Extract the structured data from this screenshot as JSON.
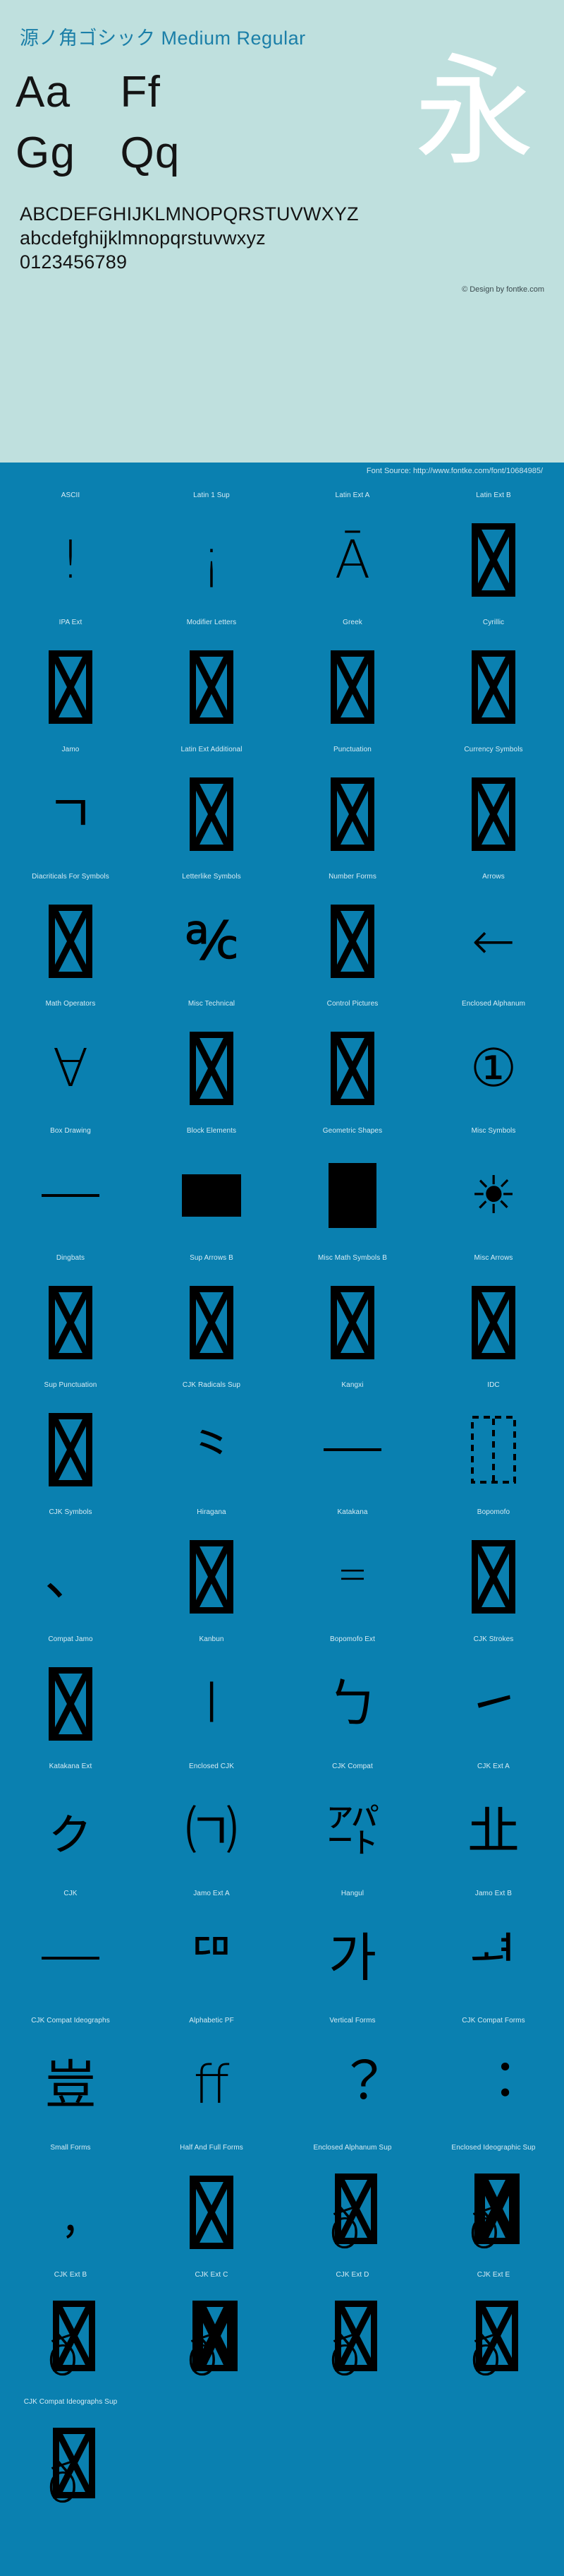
{
  "header": {
    "font_title": "源ノ角ゴシック Medium Regular",
    "specimen": {
      "row1_col1": "Aa",
      "row1_col2": "Ff",
      "row2_col1": "Gg",
      "row2_col2": "Qq",
      "cjk_sample": "永"
    },
    "alphabet_upper": "ABCDEFGHIJKLMNOPQRSTUVWXYZ",
    "alphabet_lower": "abcdefghijklmnopqrstuvwxyz",
    "digits": "0123456789",
    "copyright": "© Design by fontke.com"
  },
  "source_bar": {
    "text": "Font Source: http://www.fontke.com/font/10684985/"
  },
  "colors": {
    "header_bg": "#bfe0de",
    "body_bg": "#0a80b0",
    "title_color": "#1b7fa8",
    "glyph_color": "#000000",
    "label_color": "#d8ecf5",
    "cjk_sample_color": "#ffffff"
  },
  "blocks": [
    {
      "label": "ASCII",
      "glyph": "!",
      "kind": "glyph"
    },
    {
      "label": "Latin 1 Sup",
      "glyph": "¡",
      "kind": "glyph"
    },
    {
      "label": "Latin Ext A",
      "glyph": "Ā",
      "kind": "glyph"
    },
    {
      "label": "Latin Ext B",
      "glyph": "",
      "kind": "tofu"
    },
    {
      "label": "IPA Ext",
      "glyph": "",
      "kind": "tofu"
    },
    {
      "label": "Modifier Letters",
      "glyph": "",
      "kind": "tofu"
    },
    {
      "label": "Greek",
      "glyph": "",
      "kind": "tofu"
    },
    {
      "label": "Cyrillic",
      "glyph": "",
      "kind": "tofu"
    },
    {
      "label": "Jamo",
      "glyph": "ㄱ",
      "kind": "glyph"
    },
    {
      "label": "Latin Ext Additional",
      "glyph": "",
      "kind": "tofu"
    },
    {
      "label": "Punctuation",
      "glyph": "",
      "kind": "tofu"
    },
    {
      "label": "Currency Symbols",
      "glyph": "",
      "kind": "tofu"
    },
    {
      "label": "Diacriticals For Symbols",
      "glyph": "",
      "kind": "tofu"
    },
    {
      "label": "Letterlike Symbols",
      "glyph": "℀",
      "kind": "glyph"
    },
    {
      "label": "Number Forms",
      "glyph": "",
      "kind": "tofu"
    },
    {
      "label": "Arrows",
      "glyph": "←",
      "kind": "glyph"
    },
    {
      "label": "Math Operators",
      "glyph": "∀",
      "kind": "glyph"
    },
    {
      "label": "Misc Technical",
      "glyph": "",
      "kind": "tofu"
    },
    {
      "label": "Control Pictures",
      "glyph": "",
      "kind": "tofu"
    },
    {
      "label": "Enclosed Alphanum",
      "glyph": "①",
      "kind": "glyph"
    },
    {
      "label": "Box Drawing",
      "glyph": "─",
      "kind": "rule"
    },
    {
      "label": "Block Elements",
      "glyph": "█",
      "kind": "swatch-block"
    },
    {
      "label": "Geometric Shapes",
      "glyph": "■",
      "kind": "swatch-geom"
    },
    {
      "label": "Misc Symbols",
      "glyph": "☀",
      "kind": "glyph"
    },
    {
      "label": "Dingbats",
      "glyph": "",
      "kind": "tofu"
    },
    {
      "label": "Sup Arrows B",
      "glyph": "",
      "kind": "tofu"
    },
    {
      "label": "Misc Math Symbols B",
      "glyph": "",
      "kind": "tofu"
    },
    {
      "label": "Misc Arrows",
      "glyph": "",
      "kind": "tofu"
    },
    {
      "label": "Sup Punctuation",
      "glyph": "",
      "kind": "tofu"
    },
    {
      "label": "CJK Radicals Sup",
      "glyph": "⺀",
      "kind": "glyph"
    },
    {
      "label": "Kangxi",
      "glyph": "⼀",
      "kind": "rule"
    },
    {
      "label": "IDC",
      "glyph": "⿰",
      "kind": "dashed"
    },
    {
      "label": "CJK Symbols",
      "glyph": "、",
      "kind": "glyph"
    },
    {
      "label": "Hiragana",
      "glyph": "",
      "kind": "tofu"
    },
    {
      "label": "Katakana",
      "glyph": "゠",
      "kind": "glyph"
    },
    {
      "label": "Bopomofo",
      "glyph": "",
      "kind": "tofu"
    },
    {
      "label": "Compat Jamo",
      "glyph": "",
      "kind": "tofu"
    },
    {
      "label": "Kanbun",
      "glyph": "㆐",
      "kind": "glyph"
    },
    {
      "label": "Bopomofo Ext",
      "glyph": "ㄅ",
      "kind": "glyph"
    },
    {
      "label": "CJK Strokes",
      "glyph": "㇀",
      "kind": "glyph"
    },
    {
      "label": "Katakana Ext",
      "glyph": "ㇰ",
      "kind": "glyph"
    },
    {
      "label": "Enclosed CJK",
      "glyph": "㈀",
      "kind": "glyph"
    },
    {
      "label": "CJK Compat",
      "glyph": "㌀",
      "kind": "glyph"
    },
    {
      "label": "CJK Ext A",
      "glyph": "㐀",
      "kind": "glyph"
    },
    {
      "label": "CJK",
      "glyph": "一",
      "kind": "rule"
    },
    {
      "label": "Jamo Ext A",
      "glyph": "ꥠ",
      "kind": "glyph"
    },
    {
      "label": "Hangul",
      "glyph": "가",
      "kind": "glyph"
    },
    {
      "label": "Jamo Ext B",
      "glyph": "ힰ",
      "kind": "glyph"
    },
    {
      "label": "CJK Compat Ideographs",
      "glyph": "豈",
      "kind": "glyph"
    },
    {
      "label": "Alphabetic PF",
      "glyph": "ﬀ",
      "kind": "glyph"
    },
    {
      "label": "Vertical Forms",
      "glyph": "︖",
      "kind": "glyph"
    },
    {
      "label": "CJK Compat Forms",
      "glyph": "︓",
      "kind": "glyph"
    },
    {
      "label": "Small Forms",
      "glyph": "﹐",
      "kind": "glyph"
    },
    {
      "label": "Half And Full Forms",
      "glyph": "",
      "kind": "tofu"
    },
    {
      "label": "Enclosed Alphanum Sup",
      "glyph": "",
      "kind": "tofu-pair"
    },
    {
      "label": "Enclosed Ideographic Sup",
      "glyph": "",
      "kind": "tofu-trio"
    },
    {
      "label": "CJK Ext B",
      "glyph": "",
      "kind": "tofu-pair"
    },
    {
      "label": "CJK Ext C",
      "glyph": "",
      "kind": "tofu-trio"
    },
    {
      "label": "CJK Ext D",
      "glyph": "",
      "kind": "tofu-pair"
    },
    {
      "label": "CJK Ext E",
      "glyph": "",
      "kind": "tofu-pair"
    },
    {
      "label": "CJK Compat Ideographs Sup",
      "glyph": "",
      "kind": "tofu-pair"
    }
  ]
}
